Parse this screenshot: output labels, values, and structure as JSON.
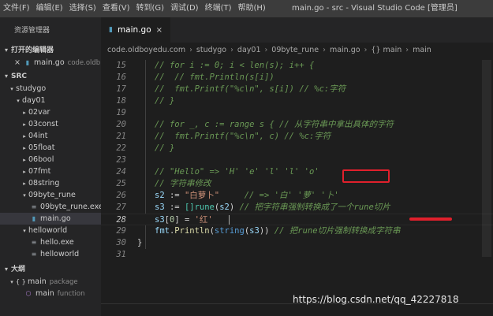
{
  "menu": [
    "文件(F)",
    "编辑(E)",
    "选择(S)",
    "查看(V)",
    "转到(G)",
    "调试(D)",
    "终端(T)",
    "帮助(H)"
  ],
  "window_title": "main.go - src - Visual Studio Code [管理员]",
  "sidebar": {
    "header": "资源管理器",
    "open_editors": {
      "title": "打开的编辑器",
      "items": [
        {
          "close": "×",
          "name": "main.go",
          "desc": "code.oldb..."
        }
      ]
    },
    "src": {
      "title": "SRC",
      "tree": [
        {
          "label": "studygo",
          "expanded": true
        },
        {
          "label": "day01",
          "expanded": true
        },
        {
          "label": "02var",
          "expanded": false
        },
        {
          "label": "03const",
          "expanded": false
        },
        {
          "label": "04int",
          "expanded": false
        },
        {
          "label": "05float",
          "expanded": false
        },
        {
          "label": "06bool",
          "expanded": false
        },
        {
          "label": "07fmt",
          "expanded": false
        },
        {
          "label": "08string",
          "expanded": false
        },
        {
          "label": "09byte_rune",
          "expanded": true
        },
        {
          "label": "09byte_rune.exe",
          "kind": "exe"
        },
        {
          "label": "main.go",
          "kind": "go"
        },
        {
          "label": "helloworld",
          "expanded": true
        },
        {
          "label": "hello.exe",
          "kind": "exe"
        },
        {
          "label": "helloworld",
          "kind": "exe"
        }
      ]
    },
    "outline": {
      "title": "大纲",
      "items": [
        {
          "icon": "{ }",
          "name": "main",
          "desc": "package"
        },
        {
          "icon": "⬡",
          "name": "main",
          "desc": "function"
        }
      ]
    }
  },
  "editor": {
    "tab": {
      "name": "main.go",
      "close": "×"
    },
    "breadcrumb": [
      "code.oldboyedu.com",
      "studygo",
      "day01",
      "09byte_rune",
      "main.go",
      "{} main",
      "main"
    ],
    "lines": [
      {
        "n": "15",
        "text": "// for i := 0; i < len(s); i++ {"
      },
      {
        "n": "16",
        "text": "//  // fmt.Println(s[i])"
      },
      {
        "n": "17",
        "text": "//  fmt.Printf(\"%c\\n\", s[i]) // %c:字符"
      },
      {
        "n": "18",
        "text": "// }"
      },
      {
        "n": "19",
        "text": ""
      },
      {
        "n": "20",
        "text": "// for _, c := range s { // 从字符串中拿出具体的字符"
      },
      {
        "n": "21",
        "text": "//  fmt.Printf(\"%c\\n\", c) // %c:字符"
      },
      {
        "n": "22",
        "text": "// }"
      },
      {
        "n": "23",
        "text": ""
      },
      {
        "n": "24",
        "text": "// \"Hello\" => 'H' 'e' 'l' 'l' 'o'"
      },
      {
        "n": "25",
        "text": "// 字符串修改"
      },
      {
        "n": "26",
        "s2": "s2",
        "assign": " := ",
        "str": "\"白萝卜\"",
        "comment": "// => '白' '萝' '卜'"
      },
      {
        "n": "27",
        "s3": "s3",
        "assign": " := ",
        "type": "[]rune",
        "arg": "s2",
        "comment": "// 把字符串强制转换成了一个rune切片"
      },
      {
        "n": "28",
        "s3": "s3",
        "idx": "0",
        "str": "'红'"
      },
      {
        "n": "29",
        "pkg": "fmt",
        "fn": "Println",
        "conv": "string",
        "arg": "s3",
        "comment": "// 把rune切片强制转换成字符串"
      },
      {
        "n": "30",
        "text": "}"
      },
      {
        "n": "31",
        "text": ""
      }
    ]
  },
  "watermark": "https://blog.csdn.net/qq_42227818"
}
